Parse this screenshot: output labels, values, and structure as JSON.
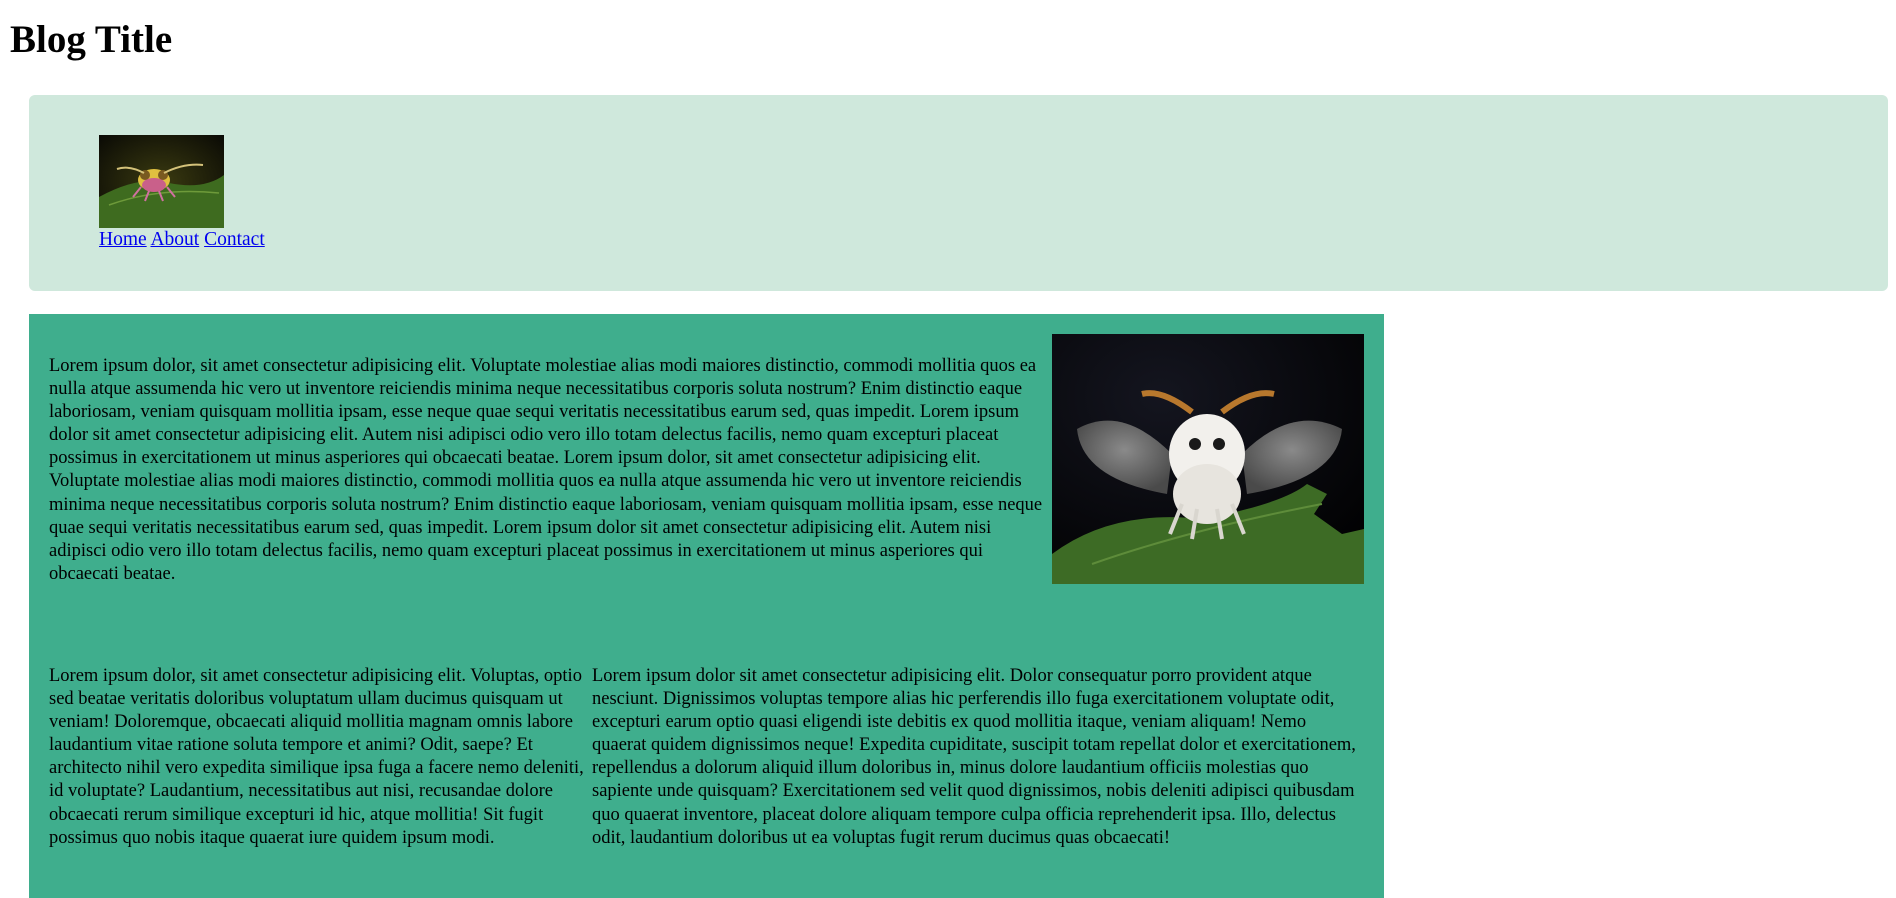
{
  "header": {
    "title": "Blog Title"
  },
  "nav": {
    "links": [
      {
        "label": "Home"
      },
      {
        "label": "About"
      },
      {
        "label": "Contact"
      }
    ]
  },
  "images": {
    "logo": "bee-moth-on-leaf-photo",
    "hero": "white-moth-on-leaf-photo"
  },
  "content": {
    "intro_text": "Lorem ipsum dolor, sit amet consectetur adipisicing elit. Voluptate molestiae alias modi maiores distinctio, commodi mollitia quos ea nulla atque assumenda hic vero ut inventore reiciendis minima neque necessitatibus corporis soluta nostrum? Enim distinctio eaque laboriosam, veniam quisquam mollitia ipsam, esse neque quae sequi veritatis necessitatibus earum sed, quas impedit. Lorem ipsum dolor sit amet consectetur adipisicing elit. Autem nisi adipisci odio vero illo totam delectus facilis, nemo quam excepturi placeat possimus in exercitationem ut minus asperiores qui obcaecati beatae. Lorem ipsum dolor, sit amet consectetur adipisicing elit. Voluptate molestiae alias modi maiores distinctio, commodi mollitia quos ea nulla atque assumenda hic vero ut inventore reiciendis minima neque necessitatibus corporis soluta nostrum? Enim distinctio eaque laboriosam, veniam quisquam mollitia ipsam, esse neque quae sequi veritatis necessitatibus earum sed, quas impedit. Lorem ipsum dolor sit amet consectetur adipisicing elit. Autem nisi adipisci odio vero illo totam delectus facilis, nemo quam excepturi placeat possimus in exercitationem ut minus asperiores qui obcaecati beatae.",
    "column_left": "Lorem ipsum dolor, sit amet consectetur adipisicing elit. Voluptas, optio sed beatae veritatis doloribus voluptatum ullam ducimus quisquam ut veniam! Doloremque, obcaecati aliquid mollitia magnam omnis labore laudantium vitae ratione soluta tempore et animi? Odit, saepe? Et architecto nihil vero expedita similique ipsa fuga a facere nemo deleniti, id voluptate? Laudantium, necessitatibus aut nisi, recusandae dolore obcaecati rerum similique excepturi id hic, atque mollitia! Sit fugit possimus quo nobis itaque quaerat iure quidem ipsum modi.",
    "column_right": "Lorem ipsum dolor sit amet consectetur adipisicing elit. Dolor consequatur porro provident atque nesciunt. Dignissimos voluptas tempore alias hic perferendis illo fuga exercitationem voluptate odit, excepturi earum optio quasi eligendi iste debitis ex quod mollitia itaque, veniam aliquam! Nemo quaerat quidem dignissimos neque! Expedita cupiditate, suscipit totam repellat dolor et exercitationem, repellendus a dolorum aliquid illum doloribus in, minus dolore laudantium officiis molestias quo sapiente unde quisquam? Exercitationem sed velit quod dignissimos, nobis deleniti adipisci quibusdam quo quaerat inventore, placeat dolore aliquam tempore culpa officia reprehenderit ipsa. Illo, delectus odit, laudantium doloribus ut ea voluptas fugit rerum ducimus quas obcaecati!"
  },
  "colors": {
    "header_background": "#cfe8dc",
    "main_background": "#3fae8d",
    "link": "#0000ee"
  }
}
